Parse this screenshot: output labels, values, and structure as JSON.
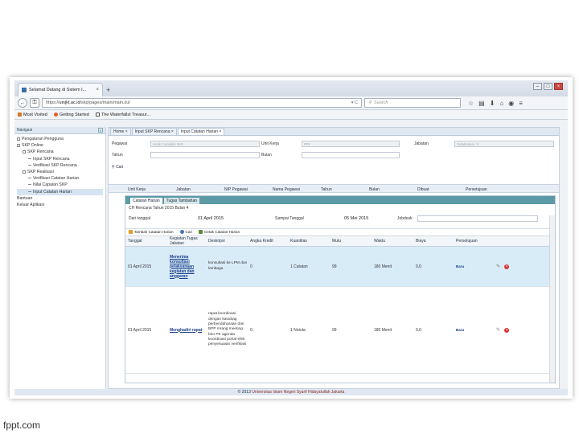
{
  "browser": {
    "tab_title": "Selamat Datang di Sistem I...",
    "new_tab": "+",
    "url_host": "uinjkt.ac.id",
    "url_prefix": "https://",
    "url_path": "/skp/pages/main/main.zul",
    "search_placeholder": "Search",
    "bookmarks": [
      "Most Visited",
      "Getting Started",
      "The WaterfallsI Treasur..."
    ]
  },
  "sidebar": {
    "header": "Navigasi",
    "items": [
      {
        "label": "Pengaturan Pengguna",
        "level": 1
      },
      {
        "label": "SKP Online",
        "level": 1
      },
      {
        "label": "SKP Rencana",
        "level": 2
      },
      {
        "label": "Input SKP Rencana",
        "level": 3
      },
      {
        "label": "Verifikasi SKP Rencana",
        "level": 3
      },
      {
        "label": "SKP Realisasi",
        "level": 2
      },
      {
        "label": "Verifikasi Catatan Harian",
        "level": 3
      },
      {
        "label": "Nilai Capaian SKP",
        "level": 3
      },
      {
        "label": "Input Catatan Harian",
        "level": 3
      },
      {
        "label": "Bantuan",
        "level": 1
      },
      {
        "label": "Keluar Aplikasi",
        "level": 1
      }
    ]
  },
  "main_tabs": [
    "Home",
    "Input SKP Rencana",
    "Input Catatan Harian"
  ],
  "filter": {
    "pegawai_label": "Pegawai",
    "pegawai_value": "Ketik Cari/pilih NIP...",
    "unit_label": "Unit Kerja",
    "unit_value": "PPI",
    "jabatan_label": "Jabatan",
    "jabatan_value": "Pelaksana / II",
    "tahun_label": "Tahun",
    "bulan_label": "Bulan",
    "cari_label": "Cari"
  },
  "grid_columns": [
    "Unit Kerja",
    "Jabatan",
    "NIP Pegawai",
    "Nama Pegawai",
    "Tahun",
    "Bulan",
    "Dibuat",
    "Persetujuan"
  ],
  "panel": {
    "tabs": [
      "Catatan Harian",
      "Tugas Tambahan"
    ],
    "info_title": "CH Rencana Tahun 2015 Bulan 4",
    "dari_label": "Dari tanggal",
    "dari_value": "01 April 2015",
    "sampai_label": "Sampai Tanggal",
    "sampai_value": "05 Mei 2015",
    "jobdesk_label": "Jobdesk",
    "actions": [
      "Tambah Catatan Harian",
      "Cari",
      "Cetak Catatan Harian"
    ]
  },
  "table": {
    "headers": [
      "Tanggal",
      "Kegiatan Tugas Jabatan",
      "Deskripsi",
      "Angka Kredit",
      "Kuantitas",
      "Mutu",
      "Waktu",
      "Biaya",
      "Persetujuan"
    ],
    "rows": [
      {
        "tanggal": "01 April 2015",
        "kegiatan": "Menerima konsultasi pelaksanaan kegiatan dan anggaran",
        "deskripsi": "konsultasi ke LPM dan lembaga",
        "angka_kredit": "0",
        "kuantitas": "1 Catatan",
        "mutu": "99",
        "waktu": "180 Menit",
        "biaya": "0,0",
        "persetujuan": "Baru"
      },
      {
        "tanggal": "01 April 2015",
        "kegiatan": "Menghadiri rapat",
        "deskripsi": "rapat koordinasi dengan kasubag perbendaharaan dan BPP mrang meeting biro PK agenda koordinasi portal efek penyesuaian verifikasi",
        "angka_kredit": "0",
        "kuantitas": "1 Notula",
        "mutu": "99",
        "waktu": "180 Menit",
        "biaya": "0,0",
        "persetujuan": "Baru"
      }
    ]
  },
  "footer": {
    "copyright": "© 2013",
    "org": "Universitas Islam Negeri Syarif Hidayatullah Jakarta"
  },
  "watermark": "fppt.com"
}
